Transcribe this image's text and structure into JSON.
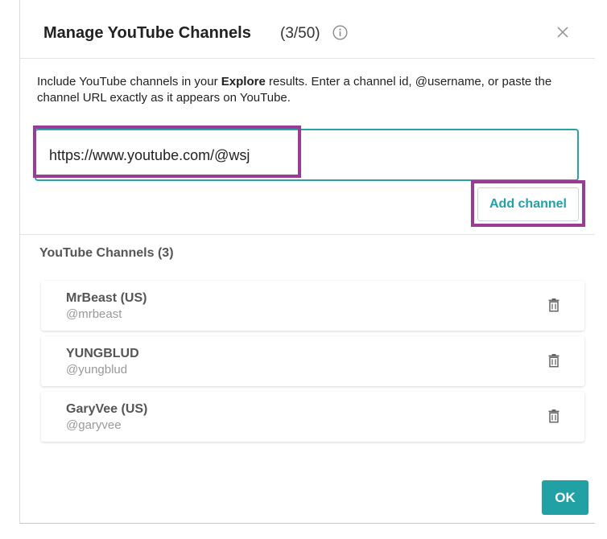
{
  "dialog": {
    "title": "Manage YouTube Channels",
    "count": "(3/50)",
    "description_prefix": "Include YouTube channels in your ",
    "description_bold": "Explore",
    "description_suffix": " results. Enter a channel id, @username, or paste the channel URL exactly as it appears on YouTube."
  },
  "input": {
    "value": "https://www.youtube.com/@wsj",
    "placeholder": ""
  },
  "buttons": {
    "add_channel": "Add channel",
    "ok": "OK"
  },
  "channels_section": {
    "title": "YouTube Channels (3)",
    "items": [
      {
        "name": "MrBeast (US)",
        "handle": "@mrbeast"
      },
      {
        "name": "YUNGBLUD",
        "handle": "@yungblud"
      },
      {
        "name": "GaryVee (US)",
        "handle": "@garyvee"
      }
    ]
  },
  "icons": {
    "info": "info-icon",
    "close": "close-icon",
    "delete": "trash-icon"
  },
  "colors": {
    "accent": "#22a1a4",
    "highlight": "#9a3b97"
  }
}
